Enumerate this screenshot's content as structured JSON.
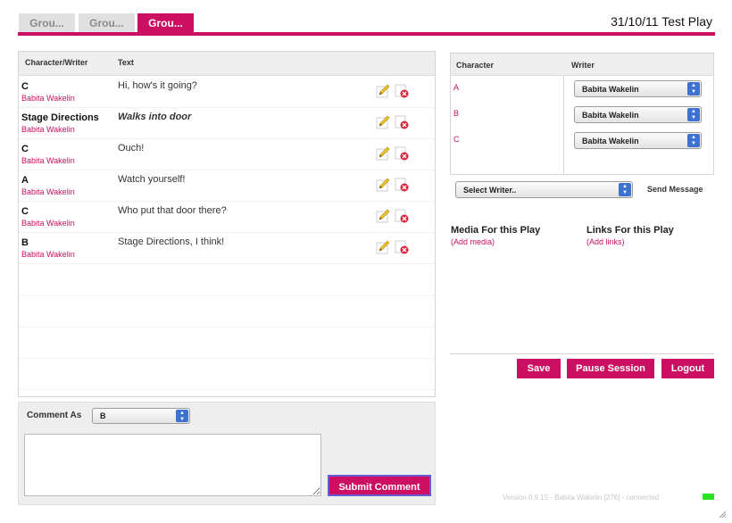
{
  "tabs": [
    "Grou...",
    "Grou...",
    "Grou..."
  ],
  "play_title": "31/10/11 Test Play",
  "script_table": {
    "headers": {
      "character": "Character/Writer",
      "text": "Text"
    },
    "rows": [
      {
        "character": "C",
        "writer": "Babita Wakelin",
        "text": "Hi, how's it going?",
        "stage": false
      },
      {
        "character": "Stage Directions",
        "writer": "Babita Wakelin",
        "text": "Walks into door",
        "stage": true
      },
      {
        "character": "C",
        "writer": "Babita Wakelin",
        "text": "Ouch!",
        "stage": false
      },
      {
        "character": "A",
        "writer": "Babita Wakelin",
        "text": "Watch yourself!",
        "stage": false
      },
      {
        "character": "C",
        "writer": "Babita Wakelin",
        "text": "Who put that door there?",
        "stage": false
      },
      {
        "character": "B",
        "writer": "Babita Wakelin",
        "text": "Stage Directions, I think!",
        "stage": false
      }
    ]
  },
  "comment": {
    "label": "Comment As",
    "selected": "B",
    "text": "",
    "submit_label": "Submit Comment"
  },
  "assignments": {
    "headers": {
      "character": "Character",
      "writer": "Writer"
    },
    "rows": [
      {
        "character": "A",
        "writer": "Babita Wakelin"
      },
      {
        "character": "B",
        "writer": "Babita Wakelin"
      },
      {
        "character": "C",
        "writer": "Babita Wakelin"
      }
    ]
  },
  "message": {
    "writer_select": "Select Writer..",
    "send_label": "Send Message"
  },
  "media": {
    "title": "Media For this Play",
    "link": "(Add media)"
  },
  "links": {
    "title": "Links For this Play",
    "link": "(Add links)"
  },
  "actions": {
    "save": "Save",
    "pause": "Pause Session",
    "logout": "Logout"
  },
  "status": {
    "text": "Version 0.9.15 - Babita Wakelin [276] - connected"
  },
  "colors": {
    "accent": "#cc0f62",
    "connected": "#2ee022",
    "select_arrow": "#3d72d1"
  },
  "icons": {
    "edit": "pencil-edit-icon",
    "delete": "delete-icon",
    "resize": "resize-grip-icon"
  }
}
